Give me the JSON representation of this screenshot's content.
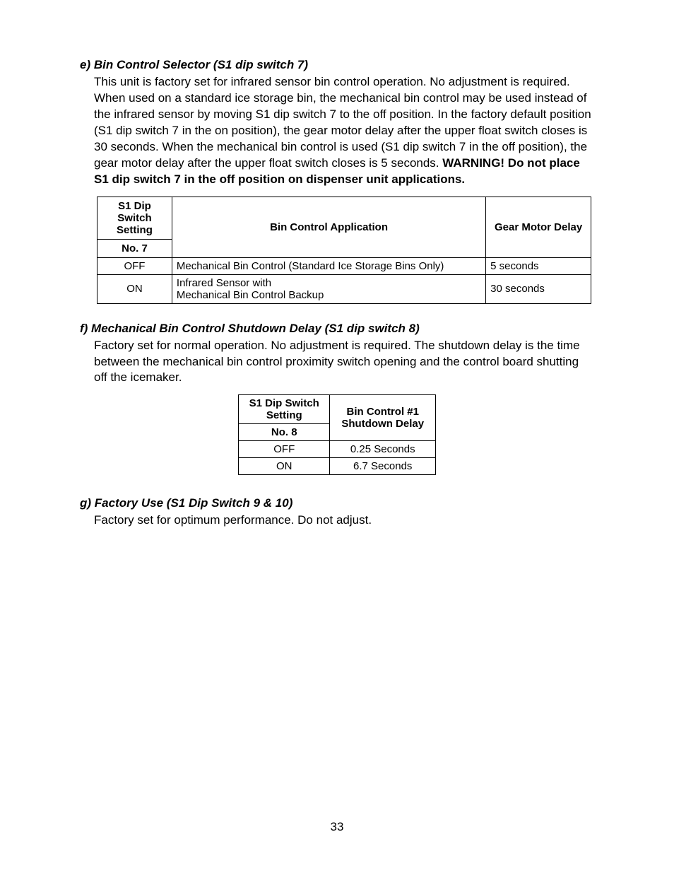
{
  "section_e": {
    "heading": "e) Bin Control Selector (S1 dip switch 7)",
    "body_part1": "This unit is factory set for infrared sensor bin control operation. No adjustment is required. When used on a standard ice storage bin, the mechanical bin control may be used instead of the infrared sensor by moving S1 dip switch 7 to the off position. In the factory default position (S1 dip switch 7 in the on position), the gear motor delay after the upper float switch closes is 30 seconds. When the mechanical bin control is used (S1 dip switch 7 in the off position), the gear motor delay after the upper float switch closes is 5 seconds. ",
    "warning": "WARNING! Do not place S1 dip switch 7 in the off position on dispenser unit applications.",
    "table": {
      "header_col1_line1": "S1 Dip Switch",
      "header_col1_line2": "Setting",
      "header_col1_sub": "No. 7",
      "header_col2": "Bin Control Application",
      "header_col3": "Gear Motor Delay",
      "rows": [
        {
          "setting": "OFF",
          "application": "Mechanical Bin Control (Standard Ice Storage Bins Only)",
          "delay": "5 seconds"
        },
        {
          "setting": "ON",
          "application_line1": "Infrared Sensor with",
          "application_line2": "Mechanical Bin Control Backup",
          "delay": "30 seconds"
        }
      ]
    }
  },
  "section_f": {
    "heading": "f) Mechanical Bin Control Shutdown Delay (S1 dip switch 8)",
    "body": "Factory set for normal operation. No adjustment is required. The shutdown delay is the time between the mechanical bin control proximity switch opening and the control board shutting off the icemaker.",
    "table": {
      "header_col1_line1": "S1 Dip Switch",
      "header_col1_line2": "Setting",
      "header_col1_sub": "No. 8",
      "header_col2_line1": "Bin Control #1",
      "header_col2_line2": "Shutdown Delay",
      "rows": [
        {
          "setting": "OFF",
          "delay": "0.25 Seconds"
        },
        {
          "setting": "ON",
          "delay": "6.7 Seconds"
        }
      ]
    }
  },
  "section_g": {
    "heading": "g) Factory Use (S1 Dip Switch 9 & 10)",
    "body": "Factory set for optimum performance. Do not adjust."
  },
  "page_number": "33"
}
